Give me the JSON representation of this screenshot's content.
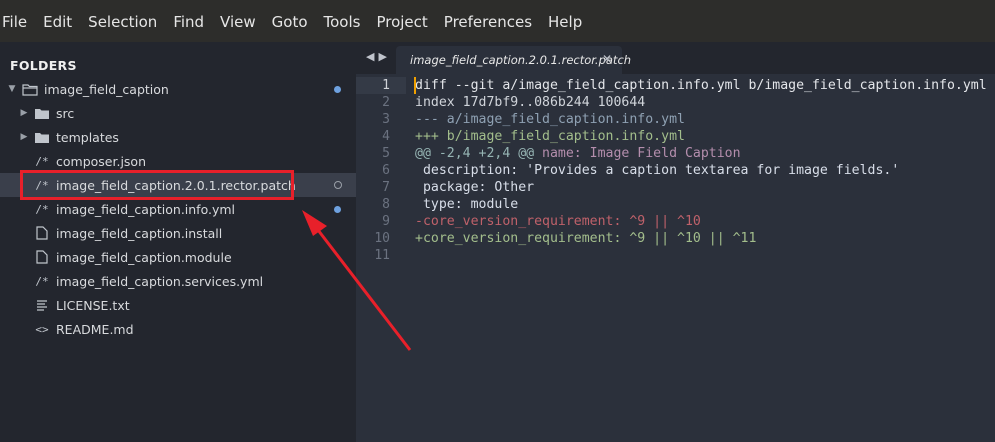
{
  "menubar": {
    "items": [
      "File",
      "Edit",
      "Selection",
      "Find",
      "View",
      "Goto",
      "Tools",
      "Project",
      "Preferences",
      "Help"
    ]
  },
  "sidebar": {
    "title": "FOLDERS",
    "root": {
      "label": "image_field_caption",
      "expanded": true,
      "modified": true
    },
    "folders": [
      {
        "label": "src",
        "expanded": false
      },
      {
        "label": "templates",
        "expanded": false
      }
    ],
    "files": [
      {
        "label": "composer.json",
        "icon": "code-comment-icon"
      },
      {
        "label": "image_field_caption.2.0.1.rector.patch",
        "icon": "code-comment-icon",
        "selected": true,
        "status": "open"
      },
      {
        "label": "image_field_caption.info.yml",
        "icon": "code-comment-icon",
        "status": "modified"
      },
      {
        "label": "image_field_caption.install",
        "icon": "file-icon"
      },
      {
        "label": "image_field_caption.module",
        "icon": "file-icon"
      },
      {
        "label": "image_field_caption.services.yml",
        "icon": "code-comment-icon"
      },
      {
        "label": "LICENSE.txt",
        "icon": "text-lines-icon"
      },
      {
        "label": "README.md",
        "icon": "angle-brackets-icon"
      }
    ]
  },
  "tabs": {
    "active_title": "image_field_caption.2.0.1.rector.patch"
  },
  "editor": {
    "line_numbers": [
      "1",
      "2",
      "3",
      "4",
      "5",
      "6",
      "7",
      "8",
      "9",
      "10",
      "11"
    ],
    "lines": {
      "l1": "diff --git a/image_field_caption.info.yml b/image_field_caption.info.yml",
      "l2": "index 17d7bf9..086b244 100644",
      "l3": "--- a/image_field_caption.info.yml",
      "l4": "+++ b/image_field_caption.info.yml",
      "l5_at": "@@ -2,4 +2,4 @@",
      "l5_text": " name: Image Field Caption",
      "l6": " description: 'Provides a caption textarea for image fields.'",
      "l7": " package: Other",
      "l8": " type: module",
      "l9": "-core_version_requirement: ^9 || ^10",
      "l10": "+core_version_requirement: ^9 || ^10 || ^11",
      "l11": ""
    }
  },
  "colors": {
    "annotation": "#e8202a",
    "modified_dot": "#6ea1e0"
  }
}
